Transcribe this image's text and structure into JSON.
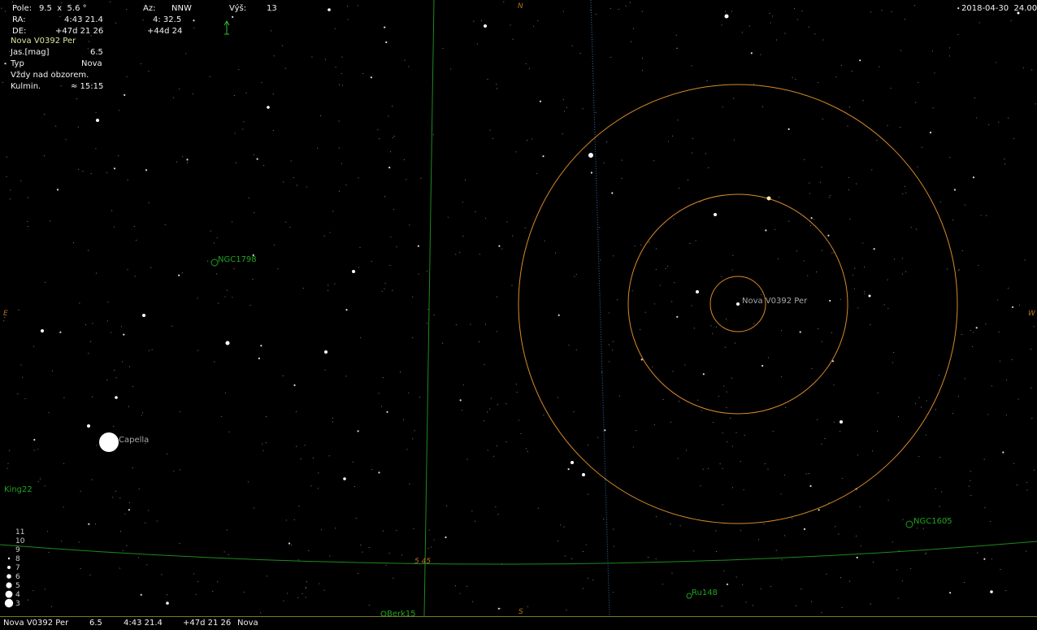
{
  "info": {
    "field_label": "Pole:",
    "field_value": "9.5  x  5.6 °",
    "ra_label": "RA:",
    "ra_value": "4:43 21.4",
    "de_label": "DE:",
    "de_value": "+47d 21 26",
    "az_label": "Az:",
    "az_value": "NNW",
    "az_value2": "4: 32.5",
    "az_value3": "+44d 24",
    "alt_label": "Výš:",
    "alt_value": "13",
    "object_name": "Nova V0392 Per",
    "mag_label": "Jas.[mag]",
    "mag_value": "6.5",
    "type_label": "Typ",
    "type_value": "Nova",
    "visibility": "Vždy nad obzorem.",
    "culm_label": "Kulmin.",
    "culm_value": "≈ 15:15"
  },
  "datetime": "2018-04-30  24.00",
  "compass": {
    "north": "N",
    "south": "S",
    "east": "E",
    "west": "W"
  },
  "labels": {
    "target": "Nova V0392 Per",
    "capella": "Capella",
    "ngc1798": "NGC1798",
    "ngc1605": "NGC1605",
    "king22": "King22",
    "ru148": "Ru148",
    "berk15": "Berk15",
    "grid_ra": "5  45"
  },
  "magnitude_scale": [
    "11",
    "10",
    "9",
    "8",
    "7",
    "6",
    "5",
    "4",
    "3"
  ],
  "status_bar": {
    "name": "Nova V0392 Per",
    "mag": "6.5",
    "ra": "4:43 21.4",
    "de": "+47d 21 26",
    "type": "Nova"
  },
  "colors": {
    "background": "#000000",
    "grid_green": "#1e8a1e",
    "ecliptic_blue": "#2f6fb0",
    "finder_orange": "#d88a2a",
    "label_green": "#1fa31f"
  }
}
